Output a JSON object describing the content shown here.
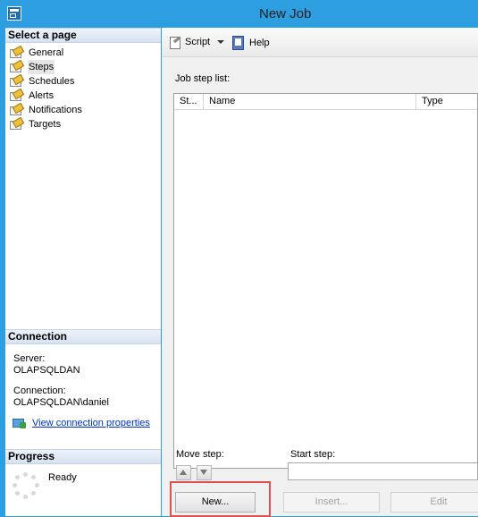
{
  "window": {
    "title": "New Job",
    "icon": "sql-window-icon"
  },
  "left_panel": {
    "select_page_header": "Select a page",
    "pages": [
      {
        "label": "General",
        "icon": "page-icon",
        "selected": false
      },
      {
        "label": "Steps",
        "icon": "page-icon",
        "selected": true
      },
      {
        "label": "Schedules",
        "icon": "page-icon",
        "selected": false
      },
      {
        "label": "Alerts",
        "icon": "page-icon",
        "selected": false
      },
      {
        "label": "Notifications",
        "icon": "page-icon",
        "selected": false
      },
      {
        "label": "Targets",
        "icon": "page-icon",
        "selected": false
      }
    ],
    "connection_header": "Connection",
    "server_label": "Server:",
    "server_value": "OLAPSQLDAN",
    "connection_label": "Connection:",
    "connection_value": "OLAPSQLDAN\\daniel",
    "view_connection_link": "View connection properties",
    "progress_header": "Progress",
    "progress_status": "Ready"
  },
  "toolbar": {
    "script_label": "Script",
    "help_label": "Help"
  },
  "main": {
    "job_step_list_label": "Job step list:",
    "columns": [
      "St...",
      "Name",
      "Type"
    ],
    "move_step_label": "Move step:",
    "start_step_label": "Start step:",
    "start_step_value": "",
    "buttons": {
      "new": "New...",
      "insert": "Insert...",
      "edit": "Edit"
    }
  },
  "colors": {
    "title_bar": "#2d9ee0",
    "highlight_box": "#e05050",
    "link": "#0033cc"
  }
}
